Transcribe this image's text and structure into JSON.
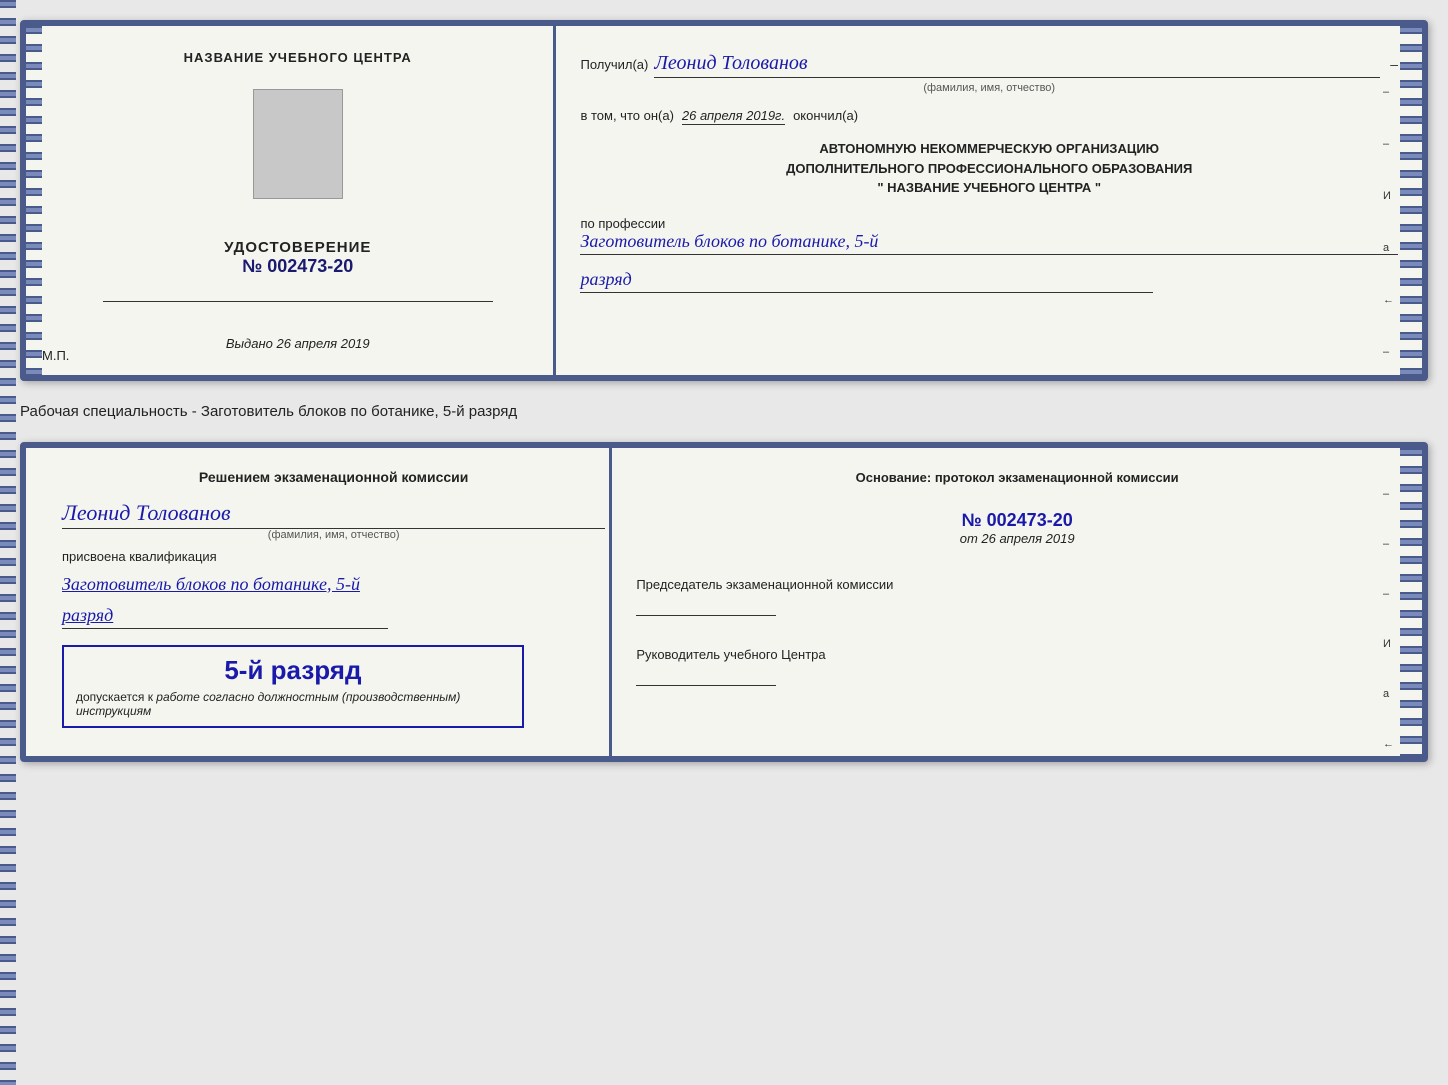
{
  "page": {
    "background": "#e8e8e8"
  },
  "upper_doc": {
    "left": {
      "org_label": "НАЗВАНИЕ УЧЕБНОГО ЦЕНТРА",
      "cert_label": "УДОСТОВЕРЕНИЕ",
      "cert_number_prefix": "№",
      "cert_number": "002473-20",
      "issued_prefix": "Выдано",
      "issued_date": "26 апреля 2019",
      "mp_label": "М.П."
    },
    "right": {
      "recipient_prefix": "Получил(а)",
      "recipient_name": "Леонид Толованов",
      "recipient_sub": "(фамилия, имя, отчество)",
      "certify_prefix": "в том, что он(а)",
      "certify_date": "26 апреля 2019г.",
      "certify_suffix": "окончил(а)",
      "org_block_line1": "АВТОНОМНУЮ НЕКОММЕРЧЕСКУЮ ОРГАНИЗАЦИЮ",
      "org_block_line2": "ДОПОЛНИТЕЛЬНОГО ПРОФЕССИОНАЛЬНОГО ОБРАЗОВАНИЯ",
      "org_block_line3": "\"  НАЗВАНИЕ УЧЕБНОГО ЦЕНТРА  \"",
      "profession_label": "по профессии",
      "profession_value": "Заготовитель блоков по ботанике, 5-й",
      "rank_value": "разряд"
    }
  },
  "middle_label": "Рабочая специальность - Заготовитель блоков по ботанике, 5-й разряд",
  "lower_doc": {
    "left": {
      "decision_text": "Решением экзаменационной комиссии",
      "person_name": "Леонид Толованов",
      "person_sub": "(фамилия, имя, отчество)",
      "qual_label": "присвоена квалификация",
      "qual_value": "Заготовитель блоков по ботанике, 5-й",
      "rank_value": "разряд",
      "rank_big": "5-й разряд",
      "допускается_prefix": "допускается к",
      "допускается_text": "работе согласно должностным (производственным) инструкциям"
    },
    "right": {
      "basis_label": "Основание: протокол экзаменационной комиссии",
      "protocol_prefix": "№",
      "protocol_number": "002473-20",
      "date_prefix": "от",
      "date_value": "26 апреля 2019",
      "chairman_label": "Председатель экзаменационной комиссии",
      "director_label": "Руководитель учебного Центра"
    }
  },
  "right_side_labels": {
    "mark1": "И",
    "mark2": "а",
    "mark3": "←"
  }
}
